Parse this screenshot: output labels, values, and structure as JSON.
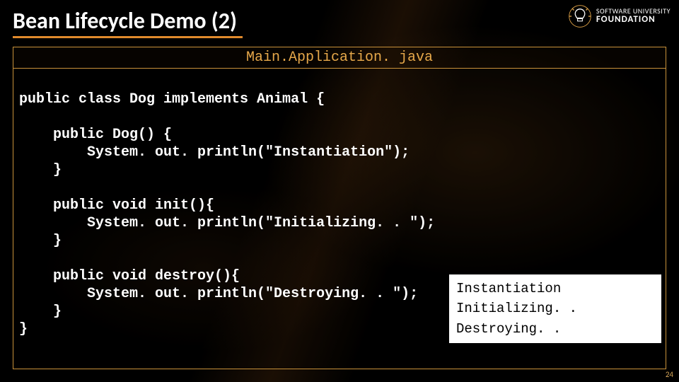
{
  "title": "Bean Lifecycle Demo (2)",
  "logo": {
    "line1": "SOFTWARE UNIVERSITY",
    "line2": "FOUNDATION"
  },
  "codebox": {
    "header": "Main.Application. java",
    "code": "public class Dog implements Animal {\n\n    public Dog() {\n        System. out. println(\"Instantiation\");\n    }\n\n    public void init(){\n        System. out. println(\"Initializing. . \");\n    }\n\n    public void destroy(){\n        System. out. println(\"Destroying. . \");\n    }\n}"
  },
  "output": "Instantiation\nInitializing. .\nDestroying. .",
  "page_number": "24"
}
